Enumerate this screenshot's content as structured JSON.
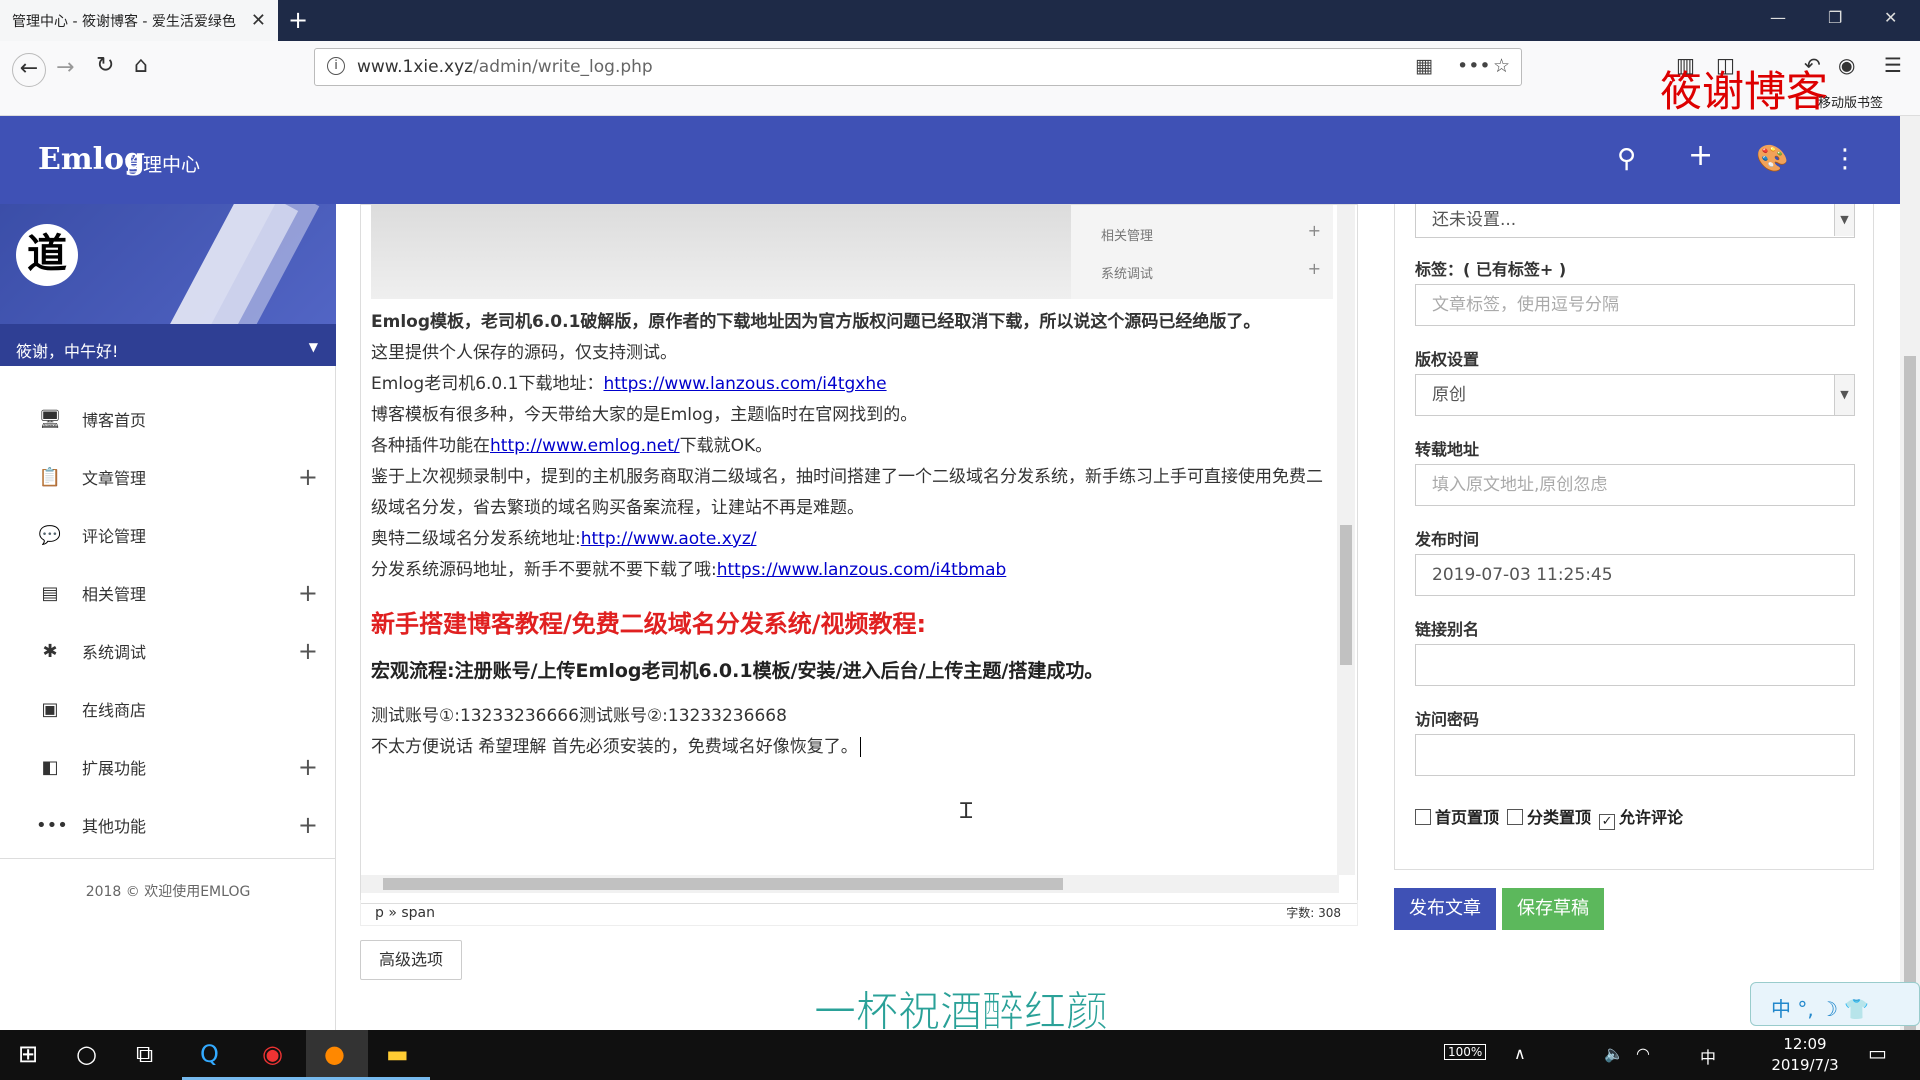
{
  "browser": {
    "tab_title": "管理中心 - 筱谢博客 - 爱生活爱绿色",
    "url_host": "www.1xie.xyz",
    "url_path": "/admin/write_log.php",
    "mobile_bookmarks": "移动版书签",
    "watermark": "筱谢博客"
  },
  "app": {
    "logo": "Emlog",
    "logo_sub": "管理中心"
  },
  "sidebar": {
    "avatar_char": "道",
    "greeting": "筱谢，中午好!",
    "items": [
      {
        "label": "博客首页",
        "icon": "monitor-icon",
        "glyph": "🖥",
        "expandable": false
      },
      {
        "label": "文章管理",
        "icon": "clipboard-icon",
        "glyph": "📋",
        "expandable": true
      },
      {
        "label": "评论管理",
        "icon": "comment-icon",
        "glyph": "💬",
        "expandable": false
      },
      {
        "label": "相关管理",
        "icon": "card-icon",
        "glyph": "▤",
        "expandable": true
      },
      {
        "label": "系统调试",
        "icon": "bug-icon",
        "glyph": "✱",
        "expandable": true
      },
      {
        "label": "在线商店",
        "icon": "store-icon",
        "glyph": "▣",
        "expandable": false
      },
      {
        "label": "扩展功能",
        "icon": "extension-icon",
        "glyph": "◧",
        "expandable": true
      },
      {
        "label": "其他功能",
        "icon": "more-icon",
        "glyph": "•••",
        "expandable": true
      }
    ],
    "footer": "2018 © 欢迎使用EMLOG"
  },
  "editor": {
    "embedded_rows": [
      "相关管理",
      "系统调试"
    ],
    "intro_bold": "Emlog模板，老司机6.0.1破解版，原作者的下载地址因为官方版权问题已经取消下载，所以说这个源码已经绝版了。",
    "line1": "这里提供个人保存的源码，仅支持测试。",
    "line2_prefix": "Emlog老司机6.0.1下载地址：",
    "line2_link": "https://www.lanzous.com/i4tgxhe",
    "line3": "博客模板有很多种，今天带给大家的是Emlog，主题临时在官网找到的。",
    "line4_prefix": "各种插件功能在",
    "line4_link": "http://www.emlog.net/",
    "line4_suffix": "下载就OK。",
    "line5": "鉴于上次视频录制中，提到的主机服务商取消二级域名，抽时间搭建了一个二级域名分发系统，新手练习上手可直接使用免费二级域名分发，省去繁琐的域名购买备案流程，让建站不再是难题。",
    "line6_prefix": "奥特二级域名分发系统地址:",
    "line6_link": "http://www.aote.xyz/",
    "line7_prefix": "分发系统源码地址，新手不要就不要下载了哦:",
    "line7_link": "https://www.lanzous.com/i4tbmab",
    "heading_red": "新手搭建博客教程/免费二级域名分发系统/视频教程:",
    "heading_black": "宏观流程:注册账号/上传Emlog老司机6.0.1模板/安装/进入后台/上传主题/搭建成功。",
    "line8": "测试账号①:13233236666测试账号②:13233236668",
    "line9": "不太方便说话  希望理解 首先必须安装的，免费域名好像恢复了。",
    "path": "p » span",
    "word_count": "字数: 308"
  },
  "advanced_button": "高级选项",
  "settings": {
    "category_value": "还未设置...",
    "tags_label": "标签：( 已有标签+ )",
    "tags_placeholder": "文章标签，使用逗号分隔",
    "copyright_label": "版权设置",
    "copyright_value": "原创",
    "repost_label": "转载地址",
    "repost_placeholder": "填入原文地址,原创忽虑",
    "time_label": "发布时间",
    "time_value": "2019-07-03 11:25:45",
    "alias_label": "链接别名",
    "alias_value": "",
    "password_label": "访问密码",
    "password_value": "",
    "check_home": "首页置顶",
    "check_cat": "分类置顶",
    "check_comment": "允许评论"
  },
  "actions": {
    "publish": "发布文章",
    "draft": "保存草稿"
  },
  "video_subtitle": "一杯祝酒醉红颜",
  "ime_text": "中 °, ☽ 👕",
  "taskbar": {
    "battery": "100%",
    "ime": "中",
    "time": "12:09",
    "date": "2019/7/3"
  },
  "colors": {
    "header": "#3f51b5",
    "publish": "#3f51b5",
    "draft": "#5cb85c",
    "heading": "#e02020"
  }
}
